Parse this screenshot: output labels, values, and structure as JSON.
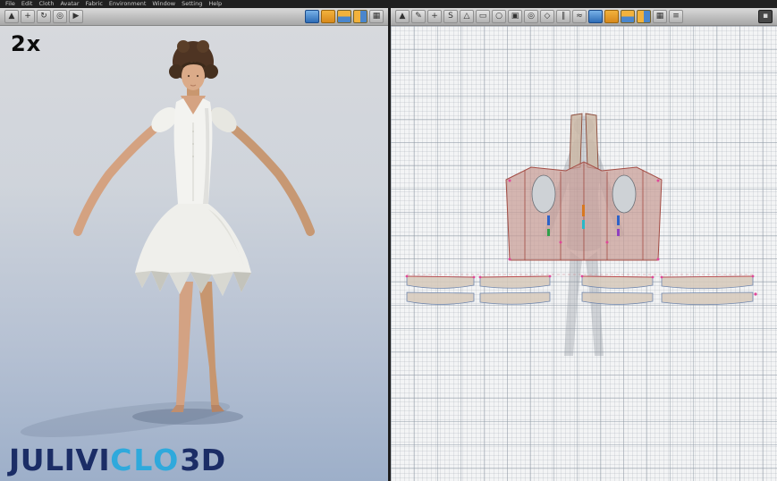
{
  "menubar": {
    "items": [
      "File",
      "Edit",
      "Cloth",
      "Avatar",
      "Fabric",
      "Environment",
      "Window",
      "Setting",
      "Help"
    ]
  },
  "toolbar3d": {
    "icons": [
      {
        "name": "select-tool-icon",
        "glyph": "▲"
      },
      {
        "name": "pan-tool-icon",
        "glyph": "+"
      },
      {
        "name": "rotate-view-icon",
        "glyph": "↻"
      },
      {
        "name": "zoom-tool-icon",
        "glyph": "◎"
      },
      {
        "name": "simulate-icon",
        "glyph": "▶"
      },
      {
        "name": "show-avatar-icon",
        "glyph": ""
      },
      {
        "name": "show-garment-icon",
        "glyph": ""
      },
      {
        "name": "sync-2d3d-icon",
        "glyph": ""
      },
      {
        "name": "render-mode-icon",
        "glyph": ""
      },
      {
        "name": "show-texture-icon",
        "glyph": "▦"
      }
    ]
  },
  "toolbar2d": {
    "icons": [
      {
        "name": "transform-tool-icon",
        "glyph": "▲"
      },
      {
        "name": "edit-pattern-icon",
        "glyph": "✎"
      },
      {
        "name": "add-point-icon",
        "glyph": "+"
      },
      {
        "name": "edit-curvature-icon",
        "glyph": "S"
      },
      {
        "name": "polygon-tool-icon",
        "glyph": "△"
      },
      {
        "name": "rectangle-tool-icon",
        "glyph": "▭"
      },
      {
        "name": "circle-tool-icon",
        "glyph": "○"
      },
      {
        "name": "internal-polygon-icon",
        "glyph": "▣"
      },
      {
        "name": "internal-circle-icon",
        "glyph": "◎"
      },
      {
        "name": "darts-tool-icon",
        "glyph": "◇"
      },
      {
        "name": "segment-sewing-icon",
        "glyph": "∥"
      },
      {
        "name": "free-sewing-icon",
        "glyph": "≈"
      },
      {
        "name": "show-sewing-icon",
        "glyph": ""
      },
      {
        "name": "show-notch-icon",
        "glyph": ""
      },
      {
        "name": "texture-editor-icon",
        "glyph": ""
      },
      {
        "name": "show-grid-icon",
        "glyph": ""
      },
      {
        "name": "pattern-outline-icon",
        "glyph": "▦"
      },
      {
        "name": "settings-icon",
        "glyph": "≡"
      },
      {
        "name": "panel-menu-icon",
        "glyph": "▪"
      }
    ]
  },
  "viewport3d": {
    "zoom_label": "2x",
    "watermark": {
      "part1": "JULIVI",
      "part2": "CLO",
      "part3": "3D"
    }
  },
  "colors": {
    "accent_blue": "#2fa9dc",
    "logo_navy": "#1b2d66",
    "pattern_fill": "#c79d96",
    "pattern_outline": "#a34c44",
    "strip_outline": "#6f86ad",
    "grid_background": "#f3f4f5",
    "viewport_sky_top": "#d7d9dd",
    "viewport_sky_bottom": "#9dafc9"
  }
}
